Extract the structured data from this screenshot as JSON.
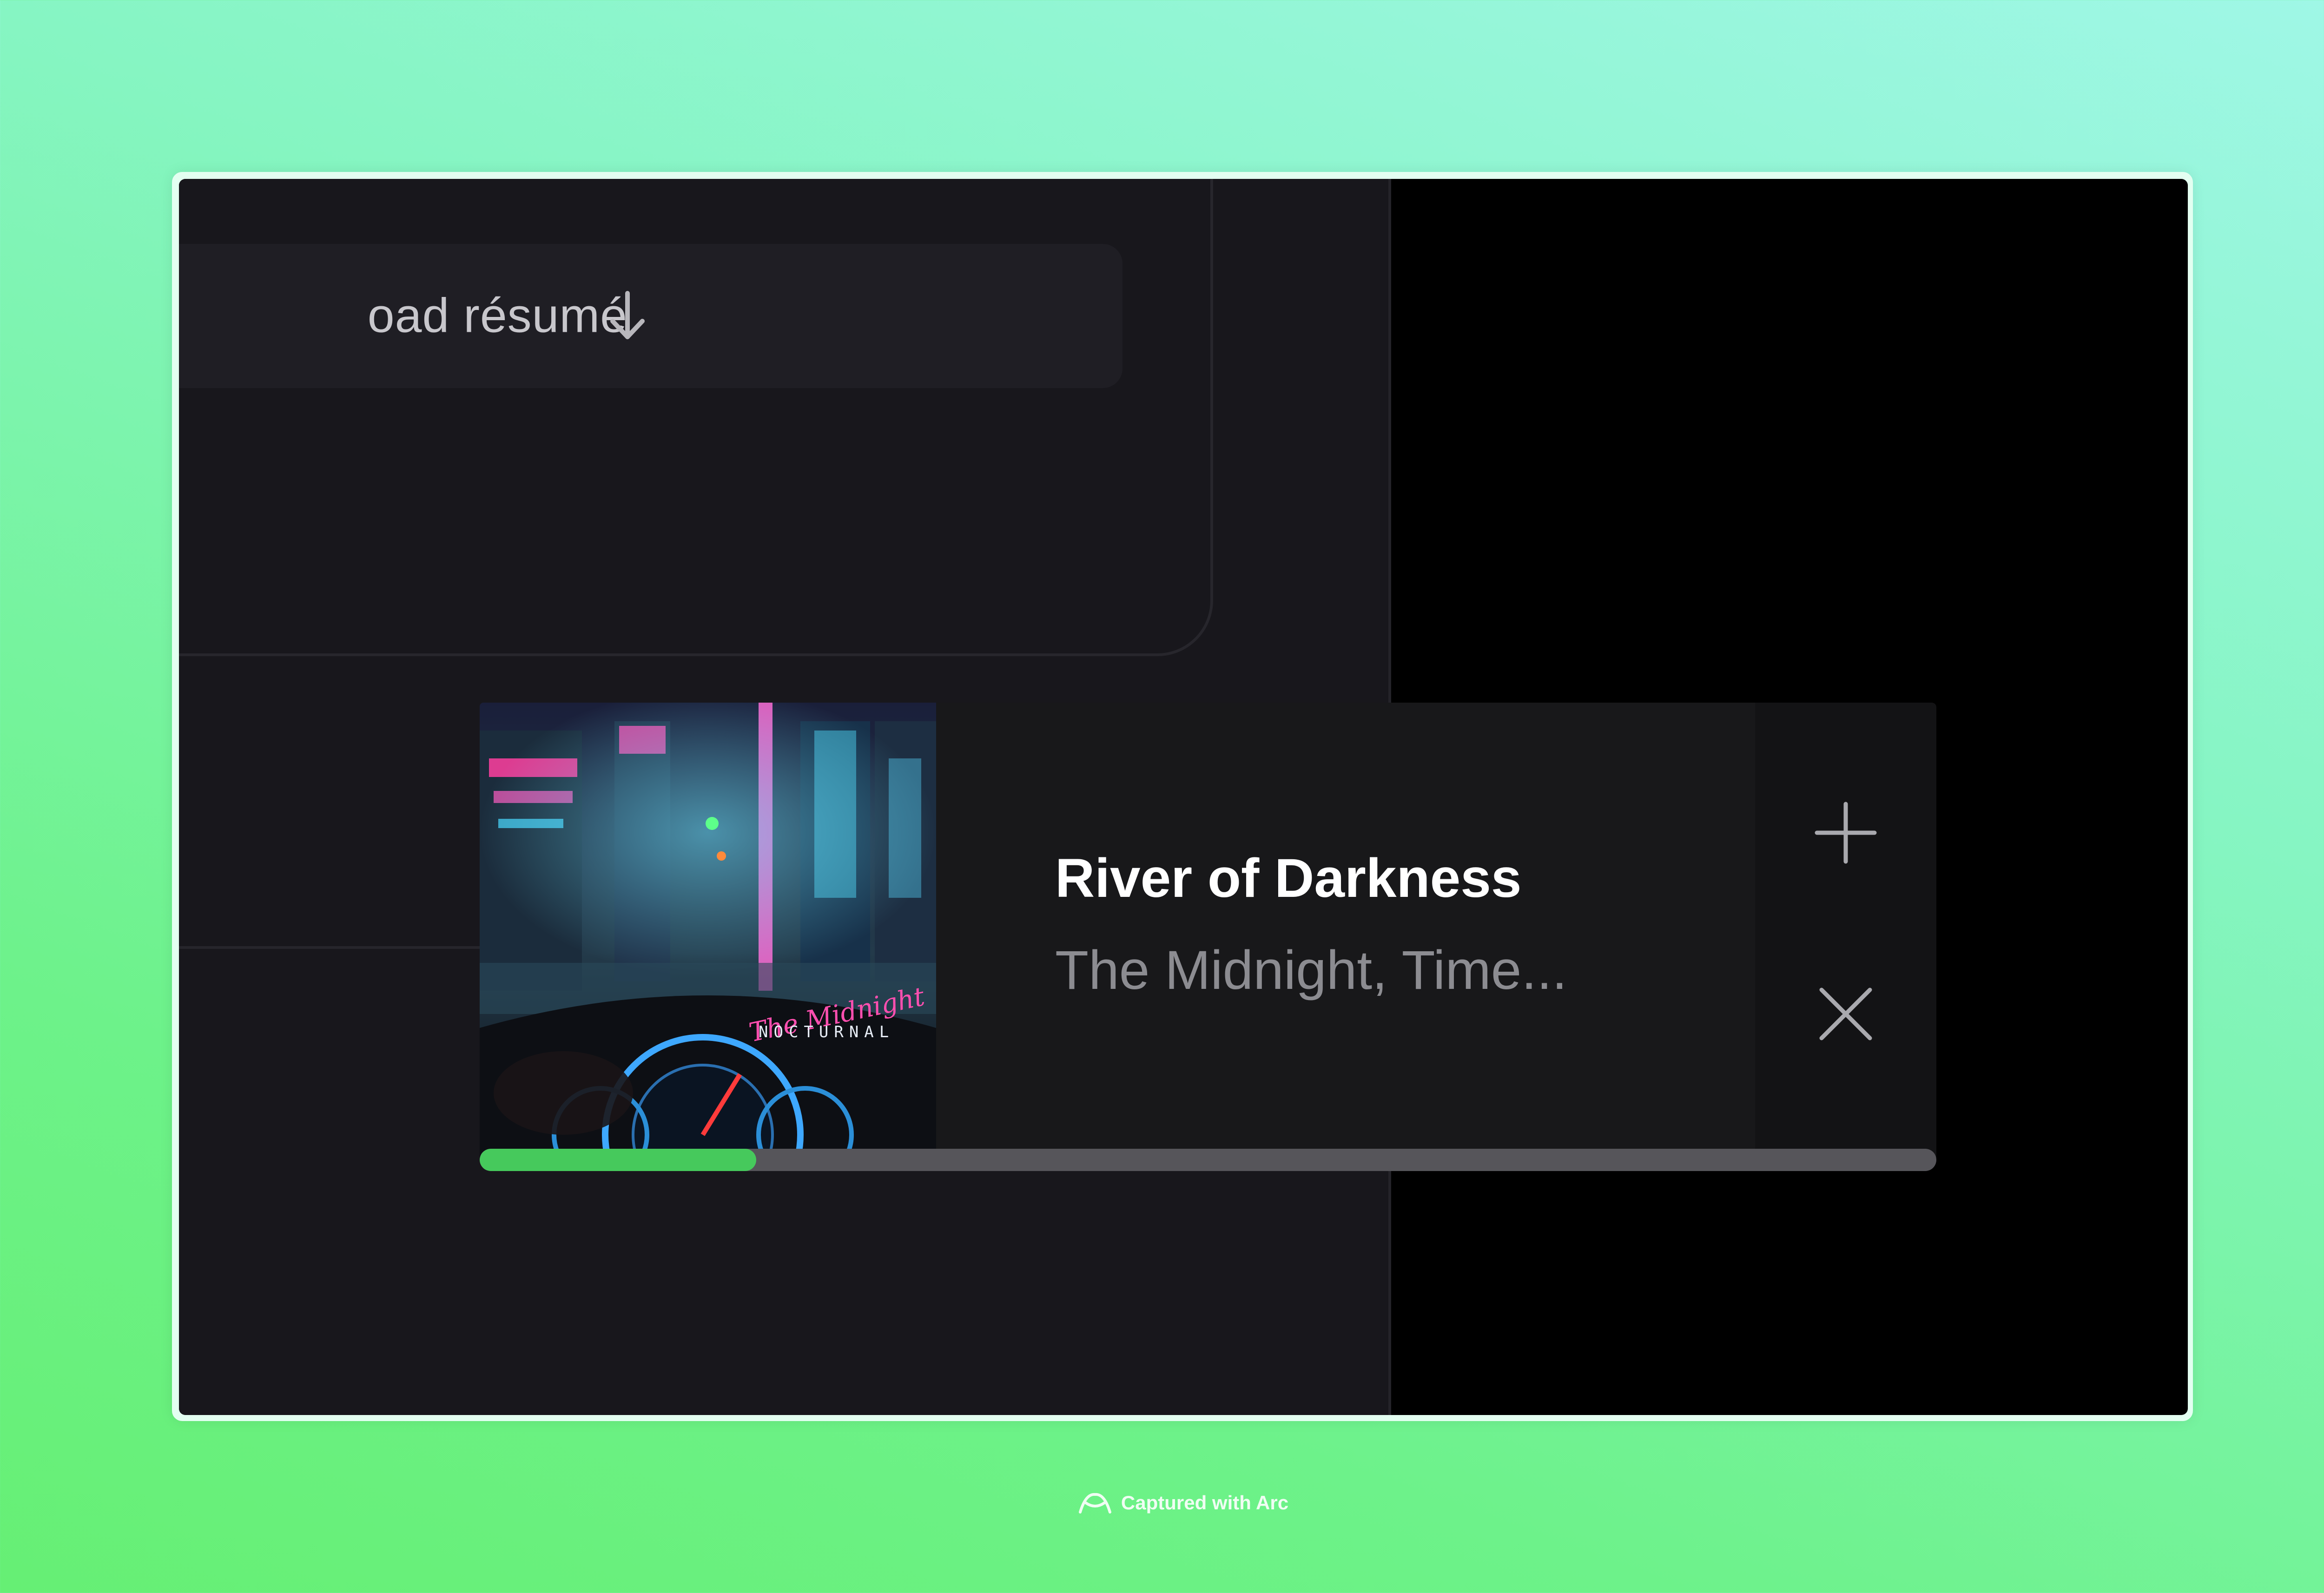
{
  "background_colors": {
    "top": "#9ff7e6",
    "bottom": "#66ef74"
  },
  "left_pane": {
    "download_button": {
      "label": "oad résumé",
      "icon": "arrow-down-icon"
    }
  },
  "player": {
    "album": {
      "art_text": "NOCTURNAL",
      "art_logo": "The Midnight"
    },
    "track": {
      "title": "River of Darkness",
      "artist": "The Midnight, Time..."
    },
    "actions": {
      "add": {
        "icon": "plus-icon"
      },
      "close": {
        "icon": "close-icon"
      }
    },
    "progress": {
      "fraction": 0.19,
      "color": "#46c95c"
    }
  },
  "watermark": {
    "text": "Captured with Arc",
    "icon": "arc-logo-icon"
  }
}
